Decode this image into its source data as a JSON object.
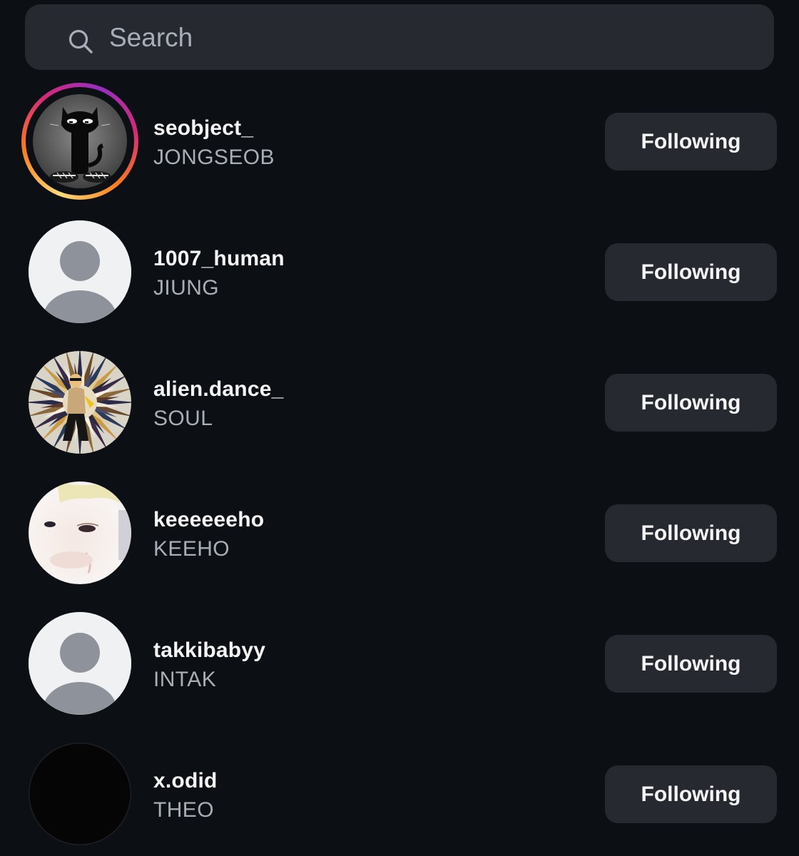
{
  "search": {
    "placeholder": "Search",
    "icon": "search-icon"
  },
  "colors": {
    "background": "#0c1014",
    "surface": "#262a30",
    "primary_text": "#f5f5f5",
    "secondary_text": "#a8aeb6"
  },
  "following_list": [
    {
      "username": "seobject_",
      "full_name": "JONGSEOB",
      "button_label": "Following",
      "avatar": "black-cat-photo",
      "has_story": true
    },
    {
      "username": "1007_human",
      "full_name": "JIUNG",
      "button_label": "Following",
      "avatar": "default-person-icon",
      "has_story": false
    },
    {
      "username": "alien.dance_",
      "full_name": "SOUL",
      "button_label": "Following",
      "avatar": "psychedelic-spiral-photo",
      "has_story": false
    },
    {
      "username": "keeeeeeho",
      "full_name": "KEEHO",
      "button_label": "Following",
      "avatar": "face-closeup-photo",
      "has_story": false
    },
    {
      "username": "takkibabyy",
      "full_name": "INTAK",
      "button_label": "Following",
      "avatar": "default-person-icon",
      "has_story": false
    },
    {
      "username": "x.odid",
      "full_name": "THEO",
      "button_label": "Following",
      "avatar": "black-photo",
      "has_story": false
    }
  ]
}
